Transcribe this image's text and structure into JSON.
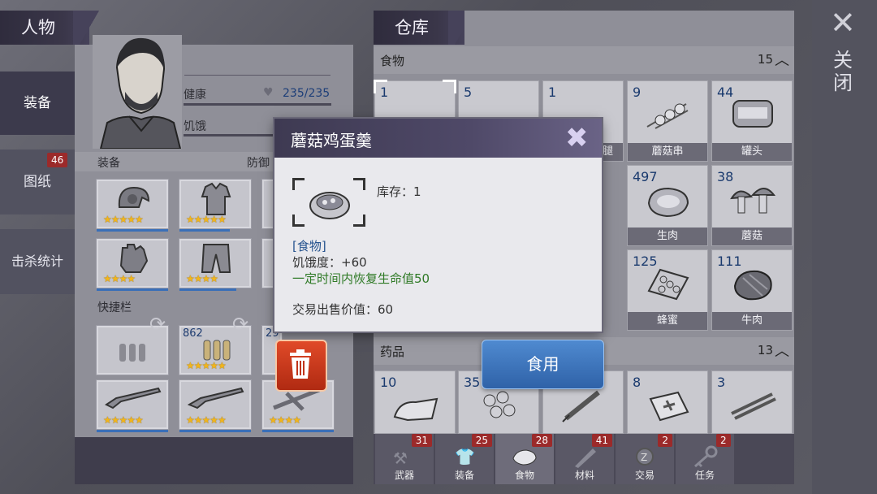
{
  "left_panel": {
    "header": "人物",
    "tabs": [
      {
        "label": "装备"
      },
      {
        "label": "图纸",
        "badge": "46"
      },
      {
        "label": "击杀统计"
      }
    ],
    "stats": {
      "health_label": "健康",
      "health_value": "235/235",
      "hunger_label": "饥饿"
    },
    "equipment_label": "装备",
    "defense_label": "防御",
    "quickbar_label": "快捷栏",
    "quickbar_counts": [
      "",
      "862",
      "29"
    ]
  },
  "warehouse": {
    "header": "仓库",
    "food": {
      "label": "食物",
      "count": "15",
      "items": [
        {
          "count": "1",
          "label": ""
        },
        {
          "count": "5",
          "label": ""
        },
        {
          "count": "1",
          "label": "腿"
        },
        {
          "count": "9",
          "label": "蘑菇串"
        },
        {
          "count": "44",
          "label": "罐头"
        },
        {
          "count": "497",
          "label": "生肉"
        },
        {
          "count": "38",
          "label": "蘑菇"
        },
        {
          "count": "125",
          "label": "蜂蜜"
        },
        {
          "count": "111",
          "label": "牛肉"
        }
      ]
    },
    "medicine": {
      "label": "药品",
      "count": "13",
      "items": [
        {
          "count": "10"
        },
        {
          "count": "35"
        },
        {
          "count": ""
        },
        {
          "count": "8"
        },
        {
          "count": "3"
        }
      ]
    },
    "bottom_tabs": [
      {
        "label": "武器",
        "badge": "31"
      },
      {
        "label": "装备",
        "badge": "25"
      },
      {
        "label": "食物",
        "badge": "28"
      },
      {
        "label": "材料",
        "badge": "41"
      },
      {
        "label": "交易",
        "badge": "2"
      },
      {
        "label": "任务",
        "badge": "2"
      }
    ]
  },
  "close_label": "关闭",
  "popup": {
    "title": "蘑菇鸡蛋羹",
    "stock": "库存：1",
    "category": "[食物]",
    "hunger": "饥饿度：+60",
    "effect": "一定时间内恢复生命值50",
    "price": "交易出售价值：60"
  },
  "use_button": "食用",
  "colors": {
    "header_bg": "#3a3649",
    "count_blue": "#1a3a6e",
    "effect_green": "#2f7a26",
    "category_blue": "#27548f",
    "badge_red": "#9b2a2a",
    "star_gold": "#f2b51a"
  }
}
